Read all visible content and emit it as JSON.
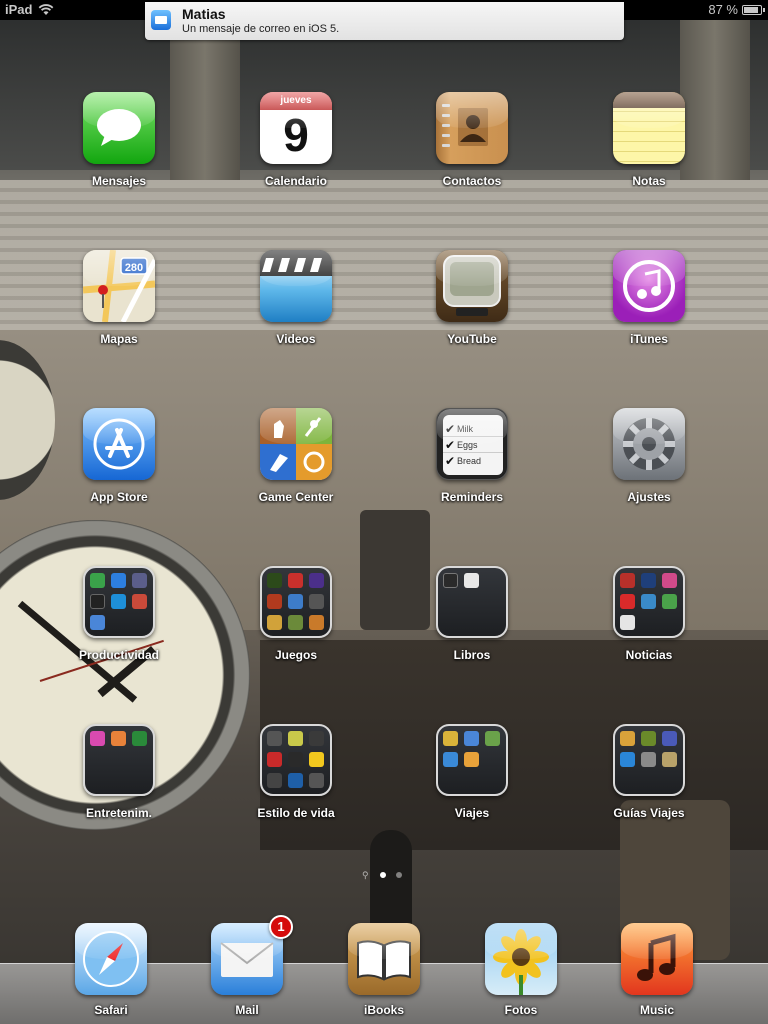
{
  "status_bar": {
    "device": "iPad",
    "battery": "87 %",
    "battery_level": 0.87
  },
  "notification": {
    "title": "Matias",
    "message": "Un mensaje de correo en iOS 5.",
    "icon": "mail-icon"
  },
  "calendar": {
    "weekday": "jueves",
    "day": "9"
  },
  "maps": {
    "route_shield": "280"
  },
  "reminders": {
    "items": [
      "Milk",
      "Eggs",
      "Bread"
    ]
  },
  "apps": [
    {
      "label": "Mensajes",
      "icon": "messages-icon"
    },
    {
      "label": "Calendario",
      "icon": "calendar-icon"
    },
    {
      "label": "Contactos",
      "icon": "contacts-icon"
    },
    {
      "label": "Notas",
      "icon": "notes-icon"
    },
    {
      "label": "Mapas",
      "icon": "maps-icon"
    },
    {
      "label": "Videos",
      "icon": "videos-icon"
    },
    {
      "label": "YouTube",
      "icon": "youtube-icon"
    },
    {
      "label": "iTunes",
      "icon": "itunes-icon"
    },
    {
      "label": "App Store",
      "icon": "appstore-icon"
    },
    {
      "label": "Game Center",
      "icon": "gamecenter-icon"
    },
    {
      "label": "Reminders",
      "icon": "reminders-icon"
    },
    {
      "label": "Ajustes",
      "icon": "settings-icon"
    }
  ],
  "folders": [
    {
      "label": "Productividad",
      "count": 7
    },
    {
      "label": "Juegos",
      "count": 9
    },
    {
      "label": "Libros",
      "count": 2
    },
    {
      "label": "Noticias",
      "count": 7
    },
    {
      "label": "Entretenim.",
      "count": 3
    },
    {
      "label": "Estilo de vida",
      "count": 9
    },
    {
      "label": "Viajes",
      "count": 5
    },
    {
      "label": "Guías Viajes",
      "count": 6
    }
  ],
  "page_indicator": {
    "pages": 2,
    "current": 1
  },
  "dock": [
    {
      "label": "Safari",
      "icon": "safari-icon"
    },
    {
      "label": "Mail",
      "icon": "mail-icon",
      "badge": "1"
    },
    {
      "label": "iBooks",
      "icon": "ibooks-icon"
    },
    {
      "label": "Fotos",
      "icon": "photos-icon"
    },
    {
      "label": "Music",
      "icon": "music-icon"
    }
  ]
}
